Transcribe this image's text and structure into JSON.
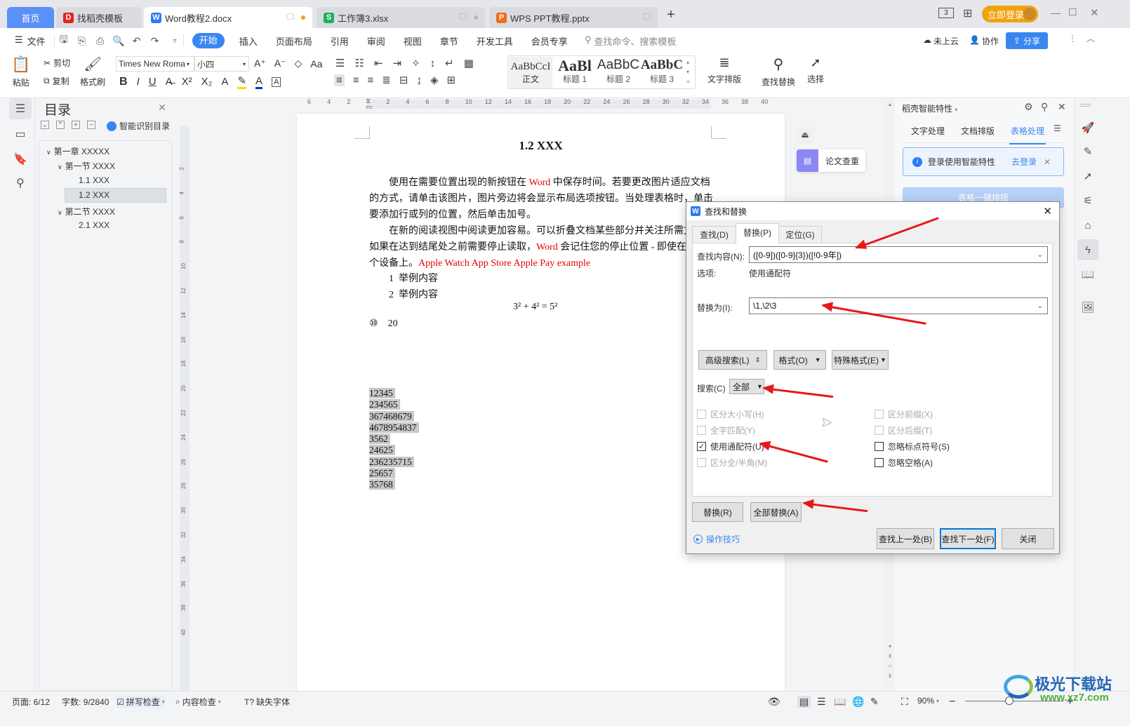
{
  "titlebar": {
    "tabs": [
      {
        "label": "首页",
        "icon": "home"
      },
      {
        "label": "找稻壳模板",
        "icon": "docer-icon"
      },
      {
        "label": "Word教程2.docx",
        "icon": "word-icon"
      },
      {
        "label": "工作簿3.xlsx",
        "icon": "sheet-icon"
      },
      {
        "label": "WPS PPT教程.pptx",
        "icon": "ppt-icon"
      }
    ],
    "new_tab": "+",
    "layout_badge": "3",
    "login_label": "立即登录",
    "win_min": "—",
    "win_max": "☐",
    "win_close": "✕"
  },
  "menubar": {
    "file_label": "文件",
    "tabs": [
      "开始",
      "插入",
      "页面布局",
      "引用",
      "审阅",
      "视图",
      "章节",
      "开发工具",
      "会员专享"
    ],
    "active_tab": "开始",
    "search_placeholder": "查找命令、搜索模板",
    "cloud_label": "未上云",
    "collab_label": "协作",
    "share_label": "分享"
  },
  "ribbon": {
    "paste": "粘贴",
    "cut": "剪切",
    "copy": "复制",
    "format_painter": "格式刷",
    "font_name": "Times New Roma",
    "font_size": "小四",
    "styles": [
      {
        "preview": "AaBbCcI",
        "label": "正文"
      },
      {
        "preview": "AaBl",
        "label": "标题 1"
      },
      {
        "preview": "AaBbC",
        "label": "标题 2"
      },
      {
        "preview": "AaBbC",
        "label": "标题 3"
      }
    ],
    "text_layout": "文字排版",
    "find_replace": "查找替换",
    "select": "选择"
  },
  "toc": {
    "title": "目录",
    "smart_label": "智能识别目录",
    "items": [
      {
        "label": "第一章  XXXXX",
        "level": 0,
        "expanded": true
      },
      {
        "label": "第一节  XXXX",
        "level": 1,
        "expanded": true
      },
      {
        "label": "1.1 XXX",
        "level": 2
      },
      {
        "label": "1.2 XXX",
        "level": 2,
        "selected": true
      },
      {
        "label": "第二节  XXXX",
        "level": 1,
        "expanded": true
      },
      {
        "label": "2.1 XXX",
        "level": 2
      }
    ]
  },
  "ruler": {
    "h_ticks": [
      "6",
      "4",
      "2",
      "2",
      "4",
      "6",
      "8",
      "10",
      "12",
      "14",
      "16",
      "18",
      "20",
      "22",
      "24",
      "26",
      "28",
      "30",
      "32",
      "34",
      "36",
      "38",
      "40"
    ],
    "v_ticks": [
      "2",
      "4",
      "6",
      "8",
      "10",
      "12",
      "14",
      "16",
      "18",
      "20",
      "22",
      "24",
      "26",
      "28",
      "30",
      "32",
      "34",
      "36",
      "38",
      "40"
    ]
  },
  "document": {
    "heading": "1.2 XXX",
    "p1": [
      {
        "t": "使用在需要位置出现的新按钮在 ",
        "red": false
      },
      {
        "t": "Word",
        "red": true
      },
      {
        "t": " 中保存时间。若要更改图片适应文档的方式，请单击该图片，图片旁边将会显示布局选项按钮。当处理表格时，单击要添加行或列的位置，然后单击加号。",
        "red": false
      }
    ],
    "p2": [
      {
        "t": "在新的阅读视图中阅读更加容易。可以折叠文档某些部分并关注所需文本。如果在达到结尾处之前需要停止读取，",
        "red": false
      },
      {
        "t": "Word",
        "red": true
      },
      {
        "t": " 会记住您的停止位置 - 即使在另一个设备上。",
        "red": false
      },
      {
        "t": "Apple Watch    App Store    Apple Pay    example",
        "red": true
      }
    ],
    "list": [
      {
        "num": "1",
        "text": "举例内容"
      },
      {
        "num": "2",
        "text": "举例内容"
      }
    ],
    "formula": "3² + 4² = 5²",
    "circled_num": "⑩",
    "circled_text": "20",
    "numbers": [
      "12345",
      "234565",
      "367468679",
      "4678954837",
      "3562",
      "24625",
      "236235715",
      "25657",
      "35768"
    ],
    "float_button": "论文查重"
  },
  "dialog": {
    "title": "查找和替换",
    "tabs": [
      "查找(D)",
      "替换(P)",
      "定位(G)"
    ],
    "active_tab": "替换(P)",
    "find_label": "查找内容(N):",
    "find_value": "([0-9])([0-9]{3})([!0-9年])",
    "options_label": "选项:",
    "options_value": "使用通配符",
    "replace_label": "替换为(I):",
    "replace_value": "\\1,\\2\\3",
    "advanced_btn": "高级搜索(L)",
    "format_btn": "格式(O)",
    "special_btn": "特殊格式(E)",
    "search_label": "搜索(C)",
    "search_value": "全部",
    "checkboxes": [
      {
        "label": "区分大小写(H)",
        "checked": false,
        "disabled": true
      },
      {
        "label": "全字匹配(Y)",
        "checked": false,
        "disabled": true
      },
      {
        "label": "使用通配符(U)",
        "checked": true,
        "disabled": false
      },
      {
        "label": "区分全/半角(M)",
        "checked": false,
        "disabled": true
      },
      {
        "label": "区分前缀(X)",
        "checked": false,
        "disabled": true
      },
      {
        "label": "区分后缀(T)",
        "checked": false,
        "disabled": true
      },
      {
        "label": "忽略标点符号(S)",
        "checked": false,
        "disabled": false
      },
      {
        "label": "忽略空格(A)",
        "checked": false,
        "disabled": false
      }
    ],
    "replace_btn": "替换(R)",
    "replace_all_btn": "全部替换(A)",
    "tips_link": "操作技巧",
    "find_prev_btn": "查找上一处(B)",
    "find_next_btn": "查找下一处(F)",
    "close_btn": "关闭"
  },
  "rightpane": {
    "title": "稻壳智能特性",
    "tabs": [
      "文字处理",
      "文档排版",
      "表格处理"
    ],
    "active_tab": "表格处理",
    "notice": "登录使用智能特性",
    "notice_link": "去登录",
    "action_btn": "表格一键排版"
  },
  "status": {
    "page": "页面: 6/12",
    "words": "字数: 9/2840",
    "spell": "拼写检查",
    "content": "内容检查",
    "missing_font": "缺失字体",
    "zoom": "90%",
    "zoom_level": 0.45,
    "watermark_cn": "极光下载站",
    "watermark_url": "www.xz7.com"
  },
  "colors": {
    "accent": "#3a86f0",
    "login": "#f2a20f",
    "red_text": "#e60000",
    "annotation_arrow": "#e81818"
  }
}
